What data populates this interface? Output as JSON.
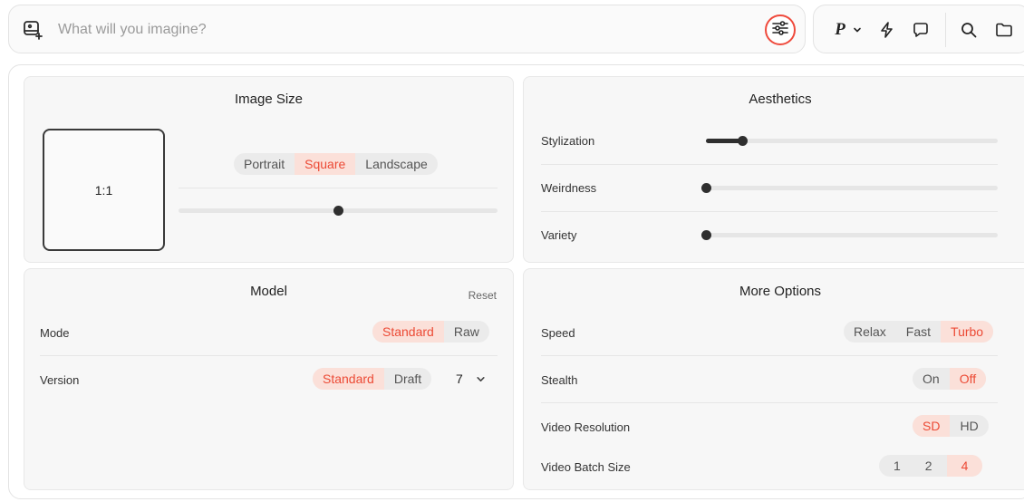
{
  "prompt": {
    "placeholder": "What will you imagine?"
  },
  "toolbar": {
    "personalize_label": "P"
  },
  "image_size": {
    "title": "Image Size",
    "ratio": "1:1",
    "orientation_options": [
      "Portrait",
      "Square",
      "Landscape"
    ],
    "selected_orientation": "Square",
    "slider_value": 0.5
  },
  "aesthetics": {
    "title": "Aesthetics",
    "sliders": [
      {
        "label": "Stylization",
        "value": 0.125
      },
      {
        "label": "Weirdness",
        "value": 0.0
      },
      {
        "label": "Variety",
        "value": 0.0
      }
    ]
  },
  "model": {
    "title": "Model",
    "reset_label": "Reset",
    "mode_label": "Mode",
    "mode_options": [
      "Standard",
      "Raw"
    ],
    "mode_selected": "Standard",
    "version_label": "Version",
    "version_options": [
      "Standard",
      "Draft"
    ],
    "version_selected": "Standard",
    "version_number": "7"
  },
  "more_options": {
    "title": "More Options",
    "speed_label": "Speed",
    "speed_options": [
      "Relax",
      "Fast",
      "Turbo"
    ],
    "speed_selected": "Turbo",
    "stealth_label": "Stealth",
    "stealth_options": [
      "On",
      "Off"
    ],
    "stealth_selected": "Off",
    "video_resolution_label": "Video Resolution",
    "video_resolution_options": [
      "SD",
      "HD"
    ],
    "video_resolution_selected": "SD",
    "video_batch_label": "Video Batch Size",
    "video_batch_options": [
      "1",
      "2",
      "4"
    ],
    "video_batch_selected": "4"
  },
  "colors": {
    "accent": "#ec4a35",
    "accent_bg": "#fbe0d9",
    "highlight_ring": "#ef4a3c"
  },
  "icons": [
    "add-image-icon",
    "settings-sliders-icon",
    "chevron-down-icon",
    "lightning-icon",
    "chat-bubble-icon",
    "search-icon",
    "folder-icon"
  ]
}
